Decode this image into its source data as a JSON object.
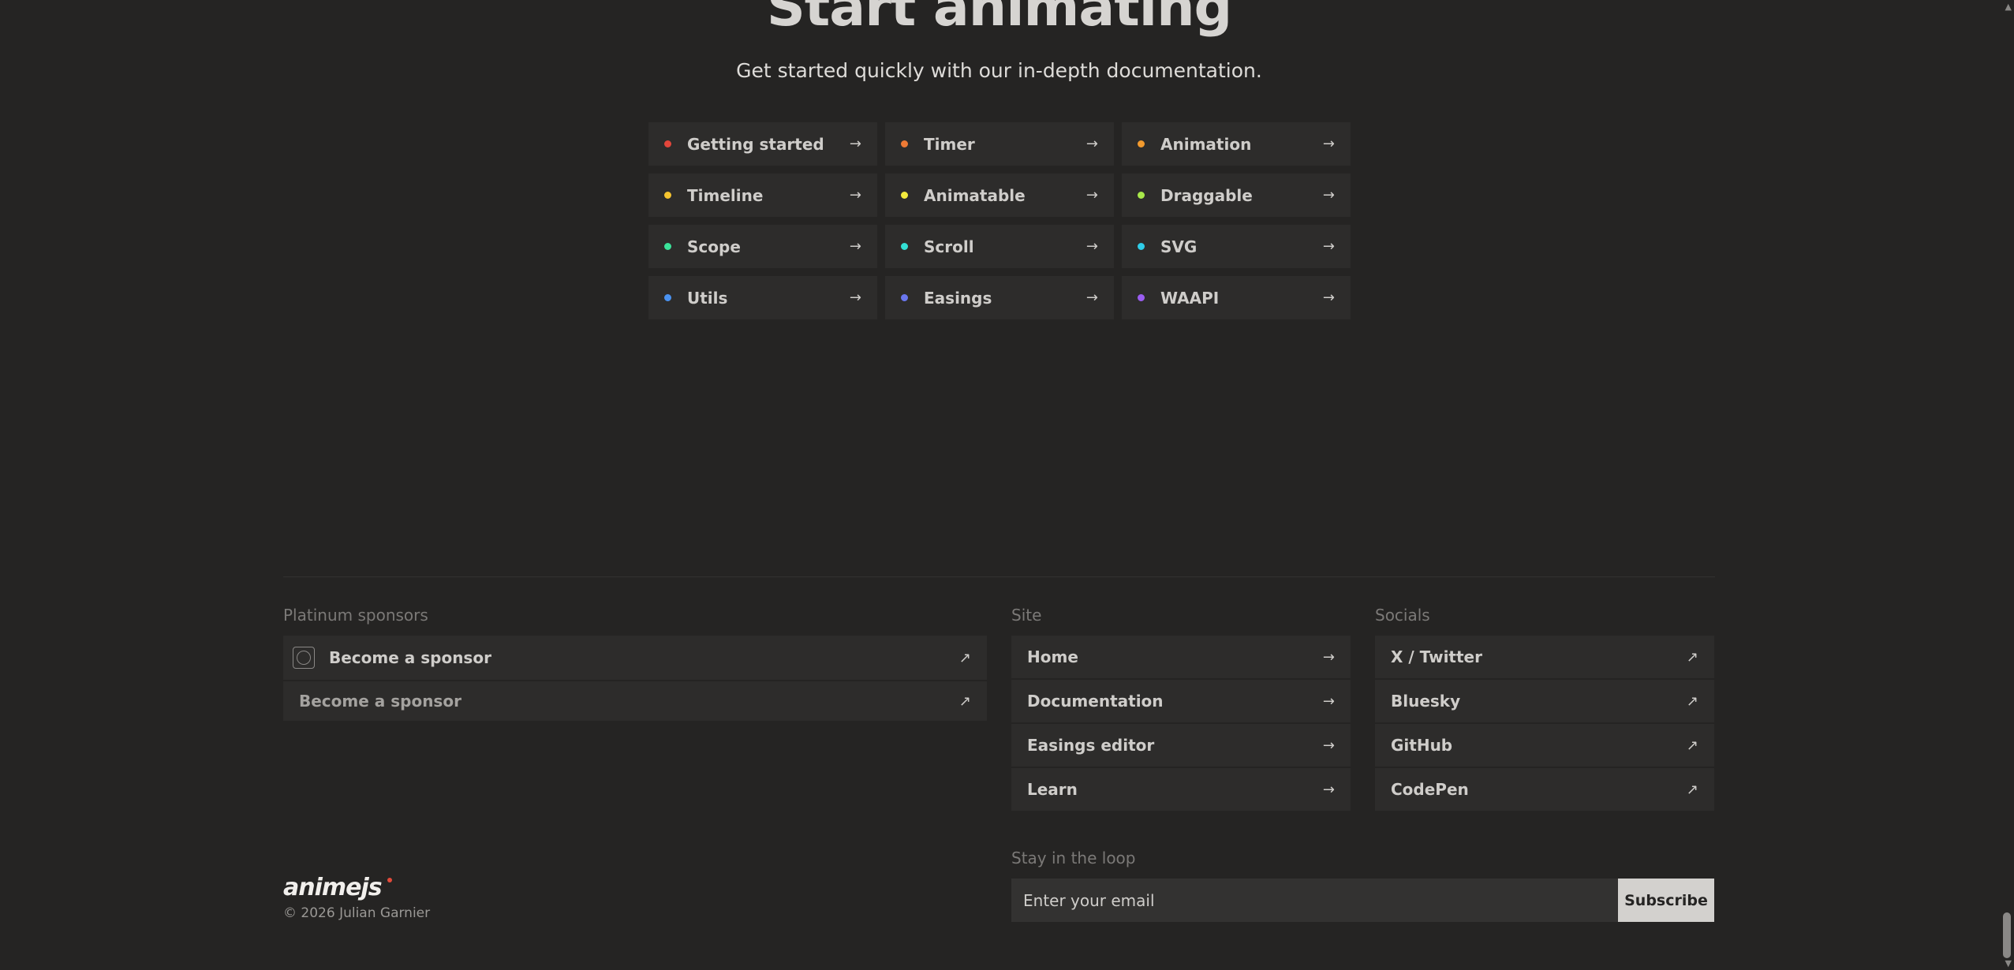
{
  "hero": {
    "title": "Start animating",
    "subtitle": "Get started quickly with our in-depth documentation."
  },
  "docs": [
    {
      "label": "Getting started",
      "color": "#e2463b"
    },
    {
      "label": "Timer",
      "color": "#ee7a35"
    },
    {
      "label": "Animation",
      "color": "#f29a2e"
    },
    {
      "label": "Timeline",
      "color": "#f5c42f"
    },
    {
      "label": "Animatable",
      "color": "#f3ea3d"
    },
    {
      "label": "Draggable",
      "color": "#a8e84a"
    },
    {
      "label": "Scope",
      "color": "#3be39a"
    },
    {
      "label": "Scroll",
      "color": "#33e0d4"
    },
    {
      "label": "SVG",
      "color": "#2fcde8"
    },
    {
      "label": "Utils",
      "color": "#4a92f0"
    },
    {
      "label": "Easings",
      "color": "#6a77ef"
    },
    {
      "label": "WAAPI",
      "color": "#9a5df0"
    }
  ],
  "footer": {
    "sponsors": {
      "heading": "Platinum sponsors",
      "items": [
        "Become a sponsor",
        "Become a sponsor"
      ]
    },
    "site": {
      "heading": "Site",
      "items": [
        "Home",
        "Documentation",
        "Easings editor",
        "Learn"
      ]
    },
    "socials": {
      "heading": "Socials",
      "items": [
        "X / Twitter",
        "Bluesky",
        "GitHub",
        "CodePen"
      ]
    },
    "newsletter": {
      "heading": "Stay in the loop",
      "placeholder": "Enter your email",
      "button": "Subscribe"
    },
    "brand": "animejs",
    "copyright": "© 2026 Julian Garnier"
  }
}
